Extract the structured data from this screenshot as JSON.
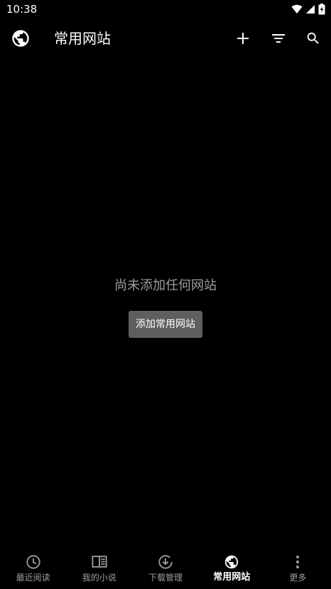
{
  "status_bar": {
    "time": "10:38"
  },
  "toolbar": {
    "title": "常用网站",
    "icons": [
      "globe-icon",
      "add-icon",
      "filter-icon",
      "search-icon"
    ]
  },
  "empty_state": {
    "message": "尚未添加任何网站",
    "button_label": "添加常用网站"
  },
  "bottom_nav": {
    "items": [
      {
        "label": "最近阅读",
        "icon": "clock-icon",
        "active": false
      },
      {
        "label": "我的小说",
        "icon": "book-icon",
        "active": false
      },
      {
        "label": "下载管理",
        "icon": "download-icon",
        "active": false
      },
      {
        "label": "常用网站",
        "icon": "globe-icon",
        "active": true
      },
      {
        "label": "更多",
        "icon": "more-vert-icon",
        "active": false
      }
    ]
  },
  "colors": {
    "background": "#000000",
    "text_primary": "#ffffff",
    "text_secondary": "#9e9e9e",
    "button_bg": "#5f5f5f"
  }
}
